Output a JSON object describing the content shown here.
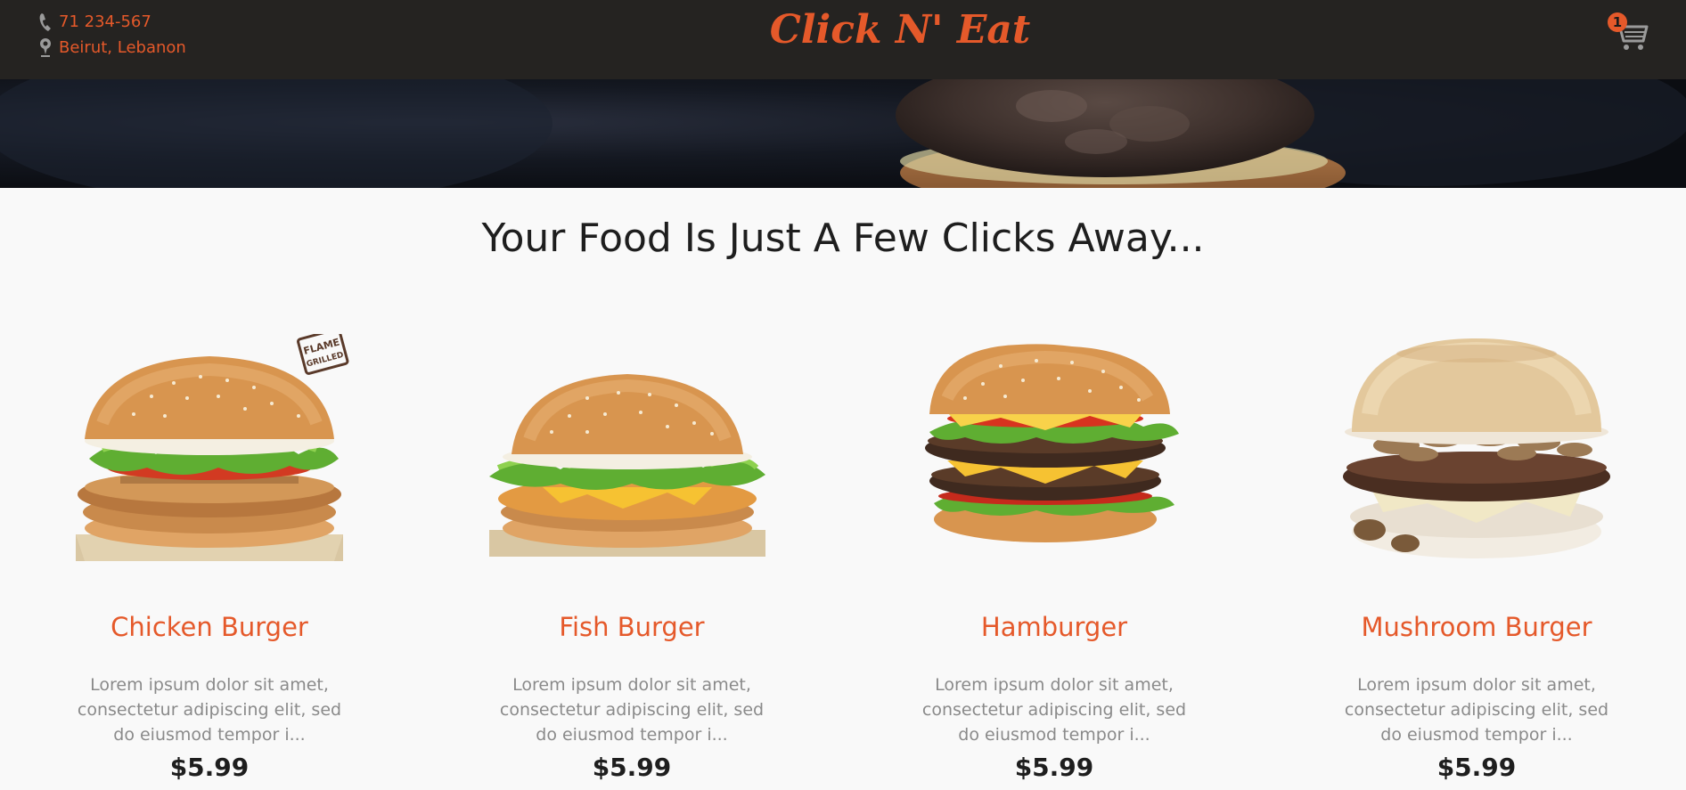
{
  "header": {
    "phone": "71 234-567",
    "location": "Beirut, Lebanon",
    "brand": "Click N' Eat",
    "cart_count": "1"
  },
  "headline": "Your Food Is Just A Few Clicks Away...",
  "products": [
    {
      "name": "Chicken Burger",
      "description": "Lorem ipsum dolor sit amet, consectetur adipiscing elit, sed do eiusmod tempor i...",
      "price": "$5.99",
      "badge": "FLAME GRILLED"
    },
    {
      "name": "Fish Burger",
      "description": "Lorem ipsum dolor sit amet, consectetur adipiscing elit, sed do eiusmod tempor i...",
      "price": "$5.99"
    },
    {
      "name": "Hamburger",
      "description": "Lorem ipsum dolor sit amet, consectetur adipiscing elit, sed do eiusmod tempor i...",
      "price": "$5.99"
    },
    {
      "name": "Mushroom Burger",
      "description": "Lorem ipsum dolor sit amet, consectetur adipiscing elit, sed do eiusmod tempor i...",
      "price": "$5.99"
    }
  ],
  "colors": {
    "accent": "#e5592a",
    "topbar": "#252321",
    "background": "#f9f9f9"
  },
  "icons": {
    "phone": "phone-icon",
    "location": "map-pin-icon",
    "cart": "cart-icon"
  }
}
